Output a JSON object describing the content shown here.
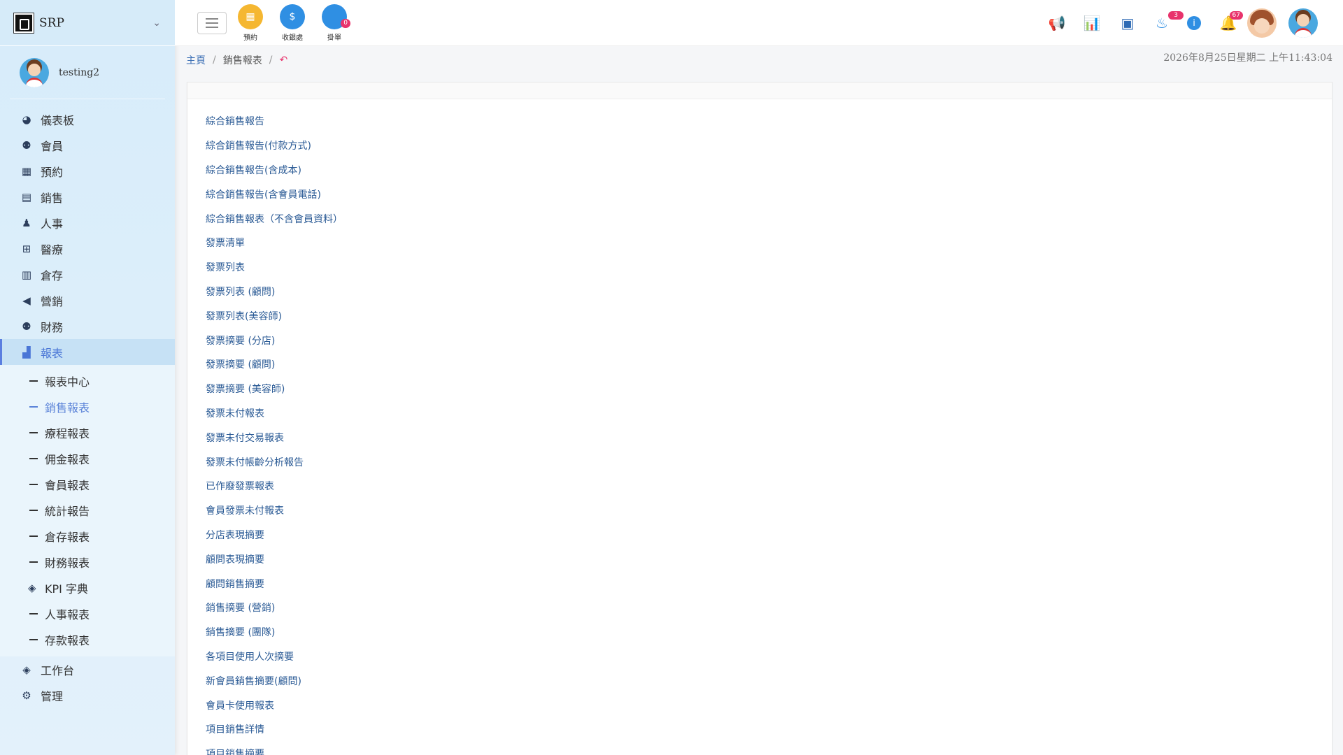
{
  "brand": {
    "name": "SRP"
  },
  "user": {
    "name": "testing2"
  },
  "nav": [
    {
      "label": "儀表板",
      "icon": "pie-chart-icon",
      "glyph": "◕"
    },
    {
      "label": "會員",
      "icon": "users-icon",
      "glyph": "👥"
    },
    {
      "label": "預約",
      "icon": "calendar-icon",
      "glyph": "▦"
    },
    {
      "label": "銷售",
      "icon": "id-card-icon",
      "glyph": "▤"
    },
    {
      "label": "人事",
      "icon": "user-icon",
      "glyph": "●"
    },
    {
      "label": "醫療",
      "icon": "medical-icon",
      "glyph": "✚"
    },
    {
      "label": "倉存",
      "icon": "warehouse-icon",
      "glyph": "▥"
    },
    {
      "label": "營銷",
      "icon": "megaphone-icon",
      "glyph": "📢"
    },
    {
      "label": "財務",
      "icon": "users-icon",
      "glyph": "👥"
    },
    {
      "label": "報表",
      "icon": "bar-chart-icon",
      "glyph": "📊"
    }
  ],
  "subnav": [
    {
      "label": "報表中心"
    },
    {
      "label": "銷售報表"
    },
    {
      "label": "療程報表"
    },
    {
      "label": "佣金報表"
    },
    {
      "label": "會員報表"
    },
    {
      "label": "統計報告"
    },
    {
      "label": "倉存報表"
    },
    {
      "label": "財務報表"
    },
    {
      "label": "KPI 字典"
    },
    {
      "label": "人事報表"
    },
    {
      "label": "存款報表"
    }
  ],
  "nav_bottom": [
    {
      "label": "工作台",
      "icon": "layers-icon"
    },
    {
      "label": "管理",
      "icon": "gear-icon"
    }
  ],
  "quick_actions": [
    {
      "label": "預約",
      "color": "#f5b731"
    },
    {
      "label": "收銀處",
      "color": "#2f8fe3"
    },
    {
      "label": "掛單",
      "color": "#2f8fe3",
      "badge": "0"
    }
  ],
  "header_badges": {
    "birthday": "3",
    "notifications": "67"
  },
  "breadcrumb": {
    "home": "主頁",
    "current": "銷售報表"
  },
  "datetime": "2026年8月25日星期二 上午11:43:04",
  "reports": [
    "綜合銷售報告",
    "綜合銷售報告(付款方式)",
    "綜合銷售報告(含成本)",
    "綜合銷售報告(含會員電話)",
    "綜合銷售報表（不含會員資料）",
    "發票清單",
    "發票列表",
    "發票列表 (顧問)",
    "發票列表(美容師)",
    "發票摘要 (分店)",
    "發票摘要 (顧問)",
    "發票摘要 (美容師)",
    "發票未付報表",
    "發票未付交易報表",
    "發票未付帳齡分析報告",
    "已作廢發票報表",
    "會員發票未付報表",
    "分店表現摘要",
    "顧問表現摘要",
    "顧問銷售摘要",
    "銷售摘要 (營銷)",
    "銷售摘要 (團隊)",
    "各項目使用人次摘要",
    "新會員銷售摘要(顧問)",
    "會員卡使用報表",
    "項目銷售詳情",
    "項目銷售摘要"
  ]
}
